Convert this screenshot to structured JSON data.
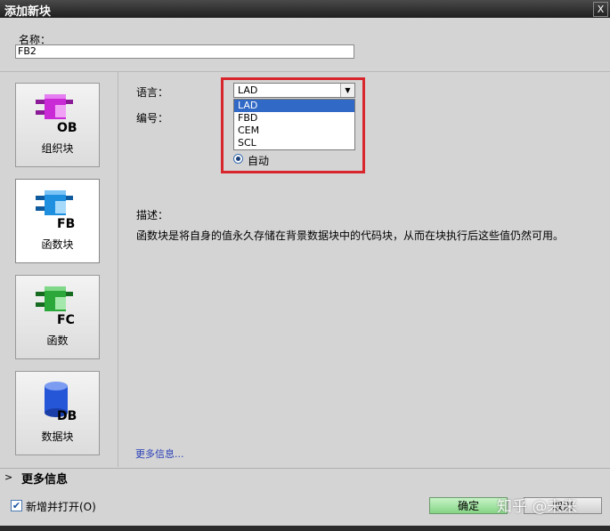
{
  "window": {
    "title": "添加新块",
    "close_label": "X"
  },
  "name_field": {
    "label": "名称：",
    "value": "FB2"
  },
  "block_types": [
    {
      "label": "组织块",
      "icon": "ob-block-icon",
      "tag": "OB",
      "color": "#c92ad6"
    },
    {
      "label": "函数块",
      "icon": "fb-block-icon",
      "tag": "FB",
      "color": "#1f8fe0"
    },
    {
      "label": "函数",
      "icon": "fc-block-icon",
      "tag": "FC",
      "color": "#2ca83a"
    },
    {
      "label": "数据块",
      "icon": "db-block-icon",
      "tag": "DB",
      "color": "#2656d8"
    }
  ],
  "language": {
    "label": "语言：",
    "selected": "LAD",
    "options": [
      "LAD",
      "FBD",
      "CEM",
      "SCL"
    ]
  },
  "number": {
    "label": "编号：",
    "radio_label": "自动"
  },
  "description": {
    "label": "描述：",
    "text": "函数块是将自身的值永久存储在背景数据块中的代码块，从而在块执行后这些值仍然可用。"
  },
  "more_info_link": "更多信息...",
  "more_info_section": {
    "title": "更多信息"
  },
  "footer": {
    "add_open_label": "新增并打开(O)",
    "ok_label": "确定",
    "cancel_label": "取消"
  },
  "watermark": "知乎 @未来",
  "colors": {
    "highlight_red": "#d9262c",
    "selection_blue": "#3169c6"
  }
}
